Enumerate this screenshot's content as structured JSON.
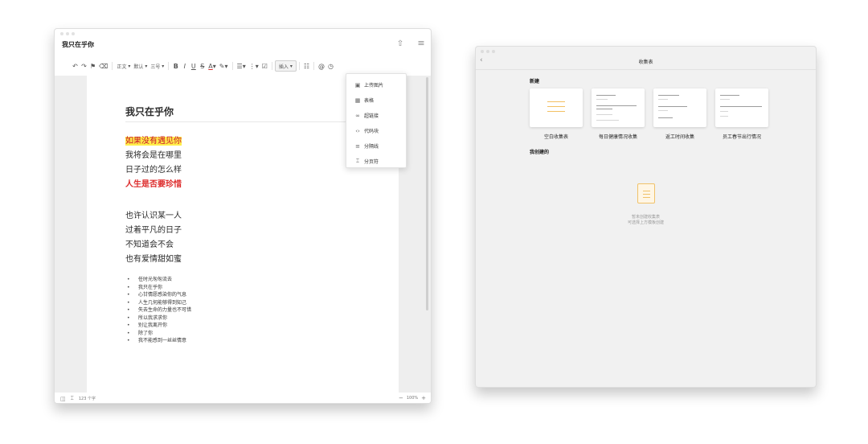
{
  "editor": {
    "title": "我只在乎你",
    "toolbar": {
      "style": "正文",
      "font": "默认",
      "size": "三号",
      "insert": "插入"
    },
    "page_title": "我只在乎你",
    "stanza1": [
      "如果没有遇见你",
      "我将会是在哪里",
      "日子过的怎么样",
      "人生是否要珍惜"
    ],
    "stanza2": [
      "也许认识某一人",
      "过着平凡的日子",
      "不知道会不会",
      "也有爱情甜如蜜"
    ],
    "bullets": [
      "任时光匆匆流去",
      "我只在乎你",
      "心甘情愿感染你的气息",
      "人生几何能够得到知己",
      "失去生命的力量也不可惜",
      "所以我求求你",
      "别让我离开你",
      "除了你",
      "我不能感到一丝丝情意"
    ],
    "insert_menu": [
      "上传图片",
      "表格",
      "超链接",
      "代码块",
      "分隔线",
      "分页符"
    ],
    "word_count": "123 个字",
    "zoom": "100%"
  },
  "forms": {
    "title": "收集表",
    "section_new": "新建",
    "templates": [
      "空白收集表",
      "每日健康情况收集",
      "返工时间收集",
      "员工春节出行情况"
    ],
    "section_mine": "我创建的",
    "empty_line1": "暂未创建收集表",
    "empty_line2": "可选择上方模板创建"
  },
  "colors": {
    "highlight": "#ffee4a",
    "red_text": "#dd2a2a",
    "accent_orange": "#f0c26a"
  }
}
